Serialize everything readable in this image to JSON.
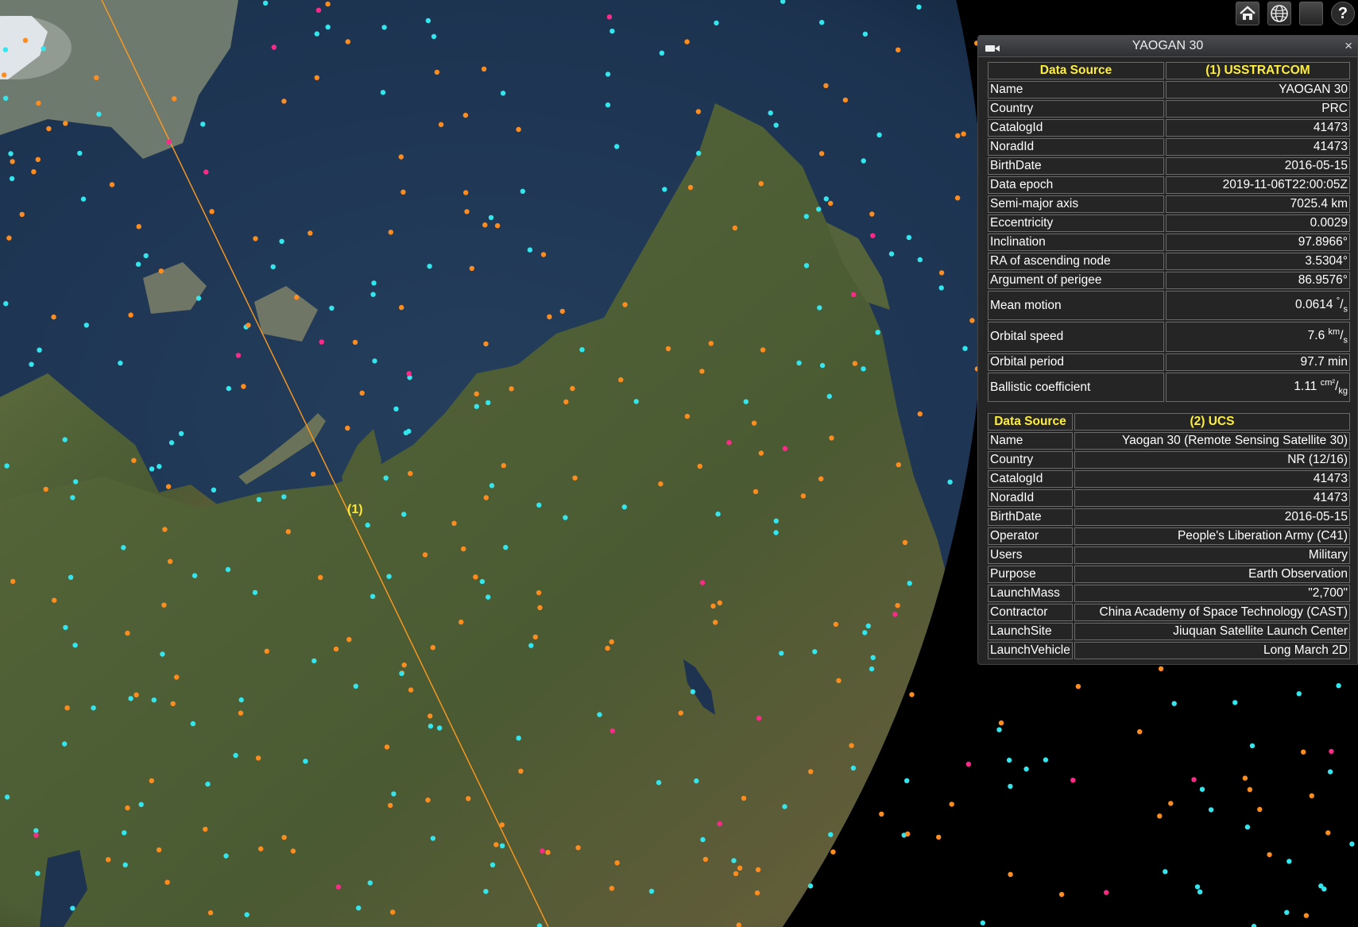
{
  "scene": {
    "track_label": "(1)",
    "colors": {
      "ocean": "#1f3550",
      "land": "#4c5b34",
      "space": "#000000",
      "track": "#ff9a1f",
      "dot_cyan": "#33e6ee",
      "dot_orange": "#ff8c1e",
      "dot_magenta": "#ff2a88",
      "label": "#ffe536"
    }
  },
  "toolbar": {
    "home_icon": "home-icon",
    "globe_icon": "globe-icon",
    "blank_icon": "empty-button",
    "help_label": "?"
  },
  "infobox": {
    "title": "YAOGAN 30",
    "close_label": "×",
    "camera_icon": "camera-icon",
    "usstratcom": {
      "header_key": "Data Source",
      "header_val": "(1) USSTRATCOM",
      "rows": [
        {
          "k": "Name",
          "v": "YAOGAN 30"
        },
        {
          "k": "Country",
          "v": "PRC"
        },
        {
          "k": "CatalogId",
          "v": "41473"
        },
        {
          "k": "NoradId",
          "v": "41473"
        },
        {
          "k": "BirthDate",
          "v": "2016-05-15"
        },
        {
          "k": "Data epoch",
          "v": "2019-11-06T22:00:05Z"
        },
        {
          "k": "Semi-major axis",
          "v": "7025.4 km"
        },
        {
          "k": "Eccentricity",
          "v": "0.0029"
        },
        {
          "k": "Inclination",
          "v": "97.8966°"
        },
        {
          "k": "RA of ascending node",
          "v": "3.5304°"
        },
        {
          "k": "Argument of perigee",
          "v": "86.9576°"
        }
      ],
      "mean_motion": {
        "k": "Mean motion",
        "v": "0.0614",
        "unit_num": "°",
        "unit_den": "s"
      },
      "orbital_speed": {
        "k": "Orbital speed",
        "v": "7.6",
        "unit_num": "km",
        "unit_den": "s"
      },
      "orbital_period": {
        "k": "Orbital period",
        "v": "97.7 min"
      },
      "ballistic": {
        "k": "Ballistic coefficient",
        "v": "1.11",
        "unit_num": "cm²",
        "unit_den": "kg"
      }
    },
    "ucs": {
      "header_key": "Data Source",
      "header_val": "(2) UCS",
      "rows": [
        {
          "k": "Name",
          "v": "Yaogan 30 (Remote Sensing Satellite 30)"
        },
        {
          "k": "Country",
          "v": "NR (12/16)"
        },
        {
          "k": "CatalogId",
          "v": "41473"
        },
        {
          "k": "NoradId",
          "v": "41473"
        },
        {
          "k": "BirthDate",
          "v": "2016-05-15"
        },
        {
          "k": "Operator",
          "v": "People's Liberation Army (C41)"
        },
        {
          "k": "Users",
          "v": "Military"
        },
        {
          "k": "Purpose",
          "v": "Earth Observation"
        },
        {
          "k": "LaunchMass",
          "v": "\"2,700\""
        },
        {
          "k": "Contractor",
          "v": "China Academy of Space Technology (CAST)"
        },
        {
          "k": "LaunchSite",
          "v": "Jiuquan Satellite Launch Center"
        },
        {
          "k": "LaunchVehicle",
          "v": "Long March 2D"
        }
      ]
    }
  }
}
